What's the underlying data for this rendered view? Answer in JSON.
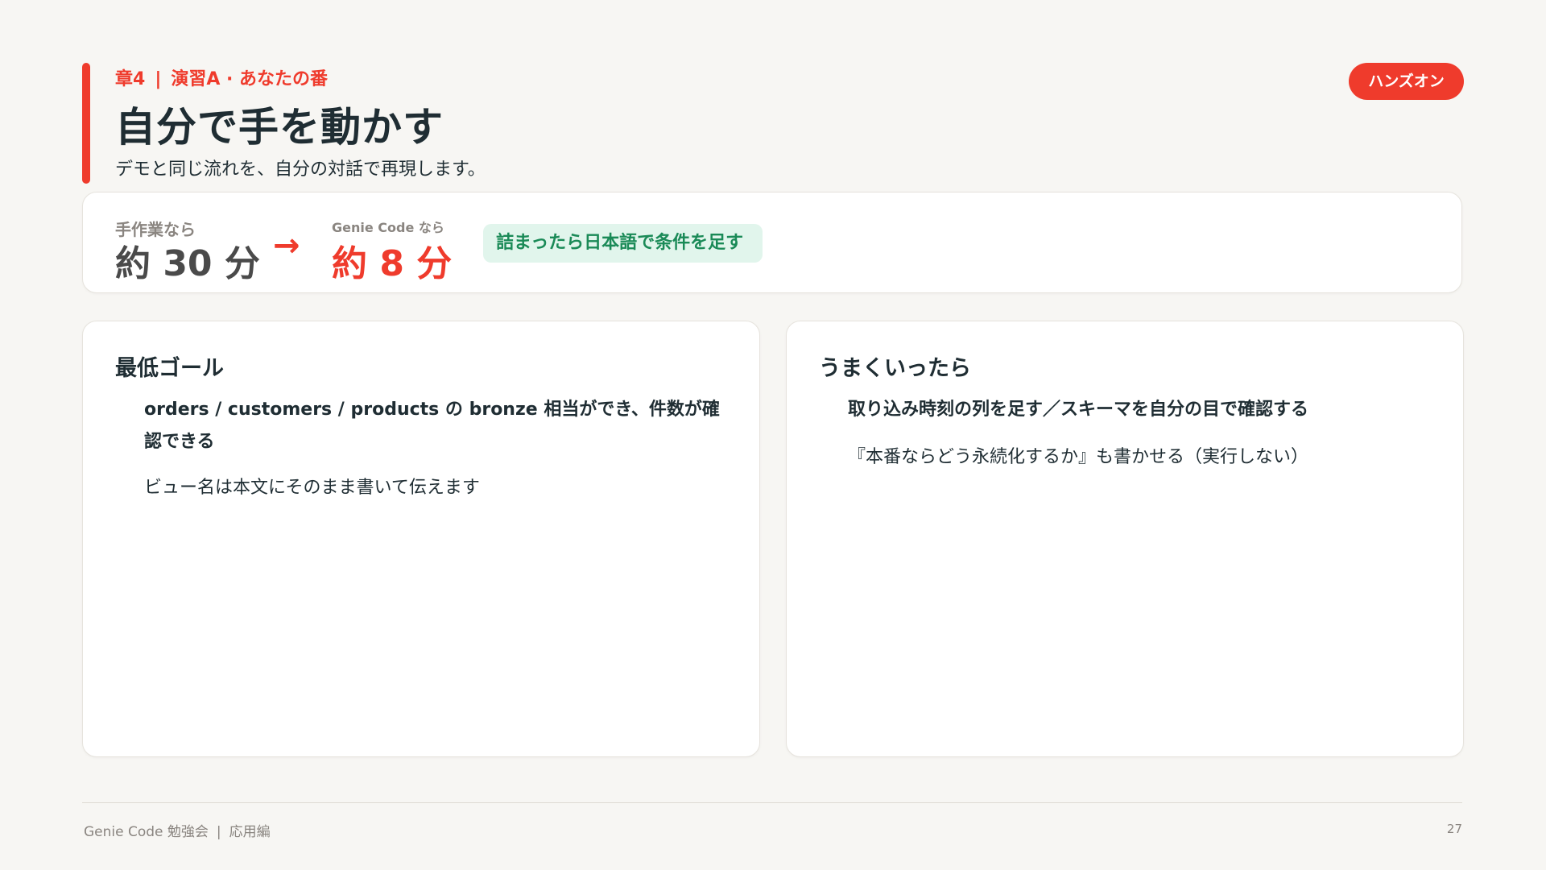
{
  "header": {
    "chapter": "章4",
    "separator": "|",
    "section": "演習A · あなたの番",
    "title": "自分で手を動かす",
    "subtitle": "デモと同じ流れを、自分の対話で再現します。",
    "tag": "ハンズオン"
  },
  "comparison": {
    "before_label": "手作業なら",
    "before_value": "約 30 分",
    "arrow": "→",
    "after_label": "Genie Code なら",
    "after_value": "約 8 分",
    "tip": "詰まったら日本語で条件を足す"
  },
  "minimum_goal": {
    "heading": "最低ゴール",
    "item": "orders / customers / products の bronze 相当ができ、件数が確認できる",
    "note": "ビュー名は本文にそのまま書いて伝えます"
  },
  "stretch_goal": {
    "heading": "うまくいったら",
    "item": "取り込み時刻の列を足す／スキーマを自分の目で確認する",
    "note": "『本番ならどう永続化するか』も書かせる（実行しない）"
  },
  "footer": {
    "brand": "Genie Code 勉強会",
    "separator": "|",
    "edition": "応用編",
    "page_number": "27"
  },
  "colors": {
    "accent": "#ef3b2c",
    "tip_background": "#e1f5ec",
    "tip_text": "#1a8a57",
    "text": "#1f2d33",
    "muted": "#8a8580",
    "background": "#f7f6f3"
  }
}
